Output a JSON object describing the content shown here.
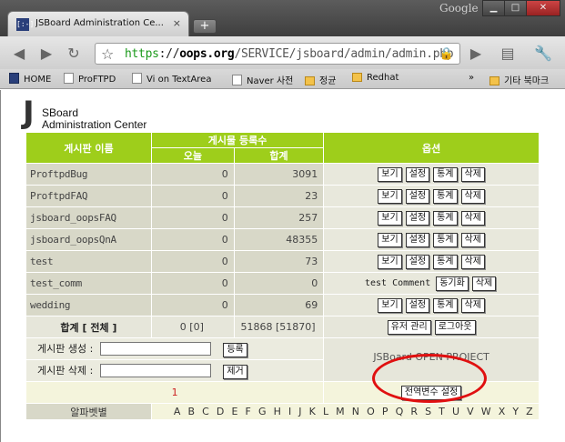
{
  "browser": {
    "tab_title": "JSBoard Administration Ce...",
    "tab_close": "×",
    "new_tab": "+",
    "brand": "Google",
    "url_scheme": "https",
    "url_host": "oops.org",
    "url_path": "/SERVICE/jsboard/admin/admin.php",
    "bookmarks": [
      "HOME",
      "ProFTPD",
      "Vi on TextArea",
      "Naver 사전",
      "정균",
      "Redhat"
    ],
    "bookmarks_overflow": "»",
    "other_bookmarks": "기타 북마크"
  },
  "logo": {
    "letter": "J",
    "line1": "SBoard",
    "line2": "Administration Center"
  },
  "table": {
    "headers": {
      "board_name": "게시판 이름",
      "posts": "게시물 등록수",
      "today": "오늘",
      "total": "합계",
      "options": "옵션"
    },
    "buttons": {
      "view": "보기",
      "settings": "설정",
      "stats": "통계",
      "delete": "삭제",
      "sync": "동기화"
    },
    "rows": [
      {
        "name": "ProftpdBug",
        "today": "0",
        "total": "3091"
      },
      {
        "name": "ProftpdFAQ",
        "today": "0",
        "total": "23"
      },
      {
        "name": "jsboard_oopsFAQ",
        "today": "0",
        "total": "257"
      },
      {
        "name": "jsboard_oopsQnA",
        "today": "0",
        "total": "48355"
      },
      {
        "name": "test",
        "today": "0",
        "total": "73"
      },
      {
        "name": "test_comm",
        "today": "0",
        "total": "0",
        "comment_label": "test Comment"
      },
      {
        "name": "wedding",
        "today": "0",
        "total": "69"
      }
    ],
    "summary": {
      "label": "합계 [ 전체 ]",
      "today": "0 [0]",
      "total": "51868 [51870]",
      "user_mgmt": "유저 관리",
      "logout": "로그아웃"
    },
    "create_label": "게시판 생성 :",
    "create_button": "등록",
    "delete_label": "게시판 삭제 :",
    "delete_button": "제거",
    "sponsor": "JSBoard OPEN PROJECT",
    "page_number": "1",
    "global_settings": "전역변수 설정",
    "alpha_label": "알파벳별",
    "alphabet": "A B C D E F G H I J K L M N O P Q R S T U V W X Y Z"
  }
}
